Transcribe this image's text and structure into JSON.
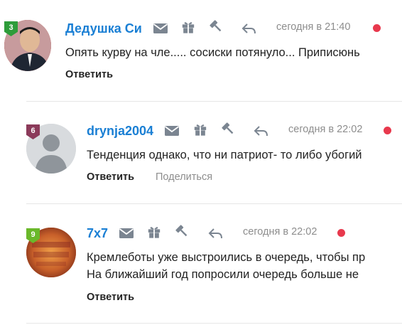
{
  "comments": [
    {
      "level": "3",
      "level_color": "#2e9c3a",
      "author": "Дедушка Си",
      "time": "сегодня в 21:40",
      "lines": [
        "Опять курву на чле..... сосиски потянуло... Приписюнь"
      ],
      "reply_label": "Ответить",
      "icons": [
        "mail-icon",
        "gift-icon",
        "gavel-icon",
        "reply-arrow-icon"
      ]
    },
    {
      "level": "6",
      "level_color": "#8b3a5a",
      "author": "drynja2004",
      "time": "сегодня в 22:02",
      "lines": [
        "Тенденция однако, что ни патриот- то либо убогий"
      ],
      "reply_label": "Ответить",
      "share_label": "Поделиться",
      "icons": [
        "mail-icon",
        "gift-icon",
        "gavel-icon",
        "reply-arrow-icon"
      ]
    },
    {
      "level": "9",
      "level_color": "#6ab82a",
      "author": "7x7",
      "time": "сегодня в 22:02",
      "lines": [
        "Кремлеботы уже выстроились в очередь, чтобы пр",
        "На ближайший год попросили очередь больше не"
      ],
      "reply_label": "Ответить",
      "icons": [
        "mail-icon",
        "gift-icon",
        "gavel-icon",
        "reply-arrow-icon"
      ]
    }
  ],
  "colors": {
    "author": "#1a7fd4",
    "online_dot": "#e8394d",
    "muted": "#8d8d8d"
  }
}
